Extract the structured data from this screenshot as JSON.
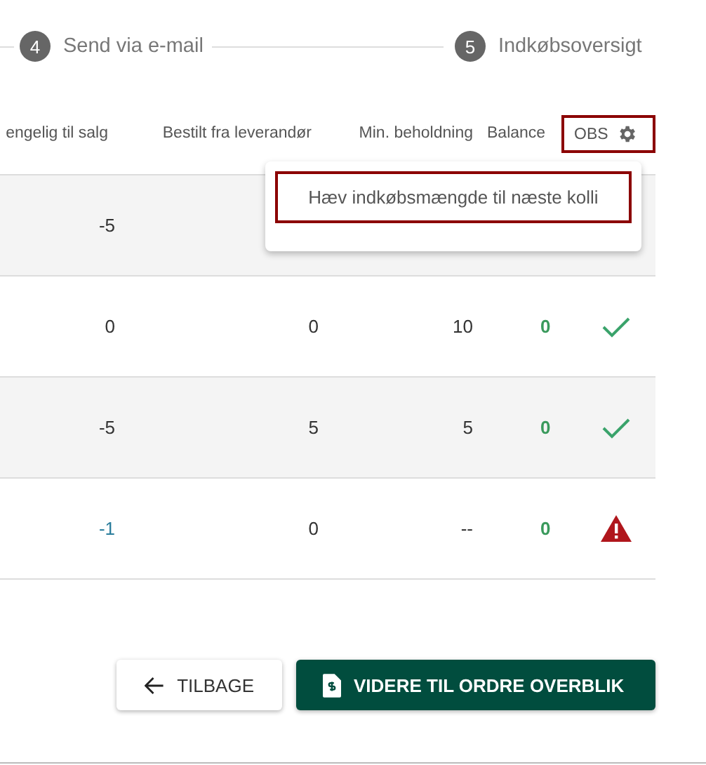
{
  "stepper": [
    {
      "number": "4",
      "label": "Send via e-mail"
    },
    {
      "number": "5",
      "label": "Indkøbsoversigt"
    }
  ],
  "table": {
    "columns": [
      "engelig til salg",
      "Bestilt fra leverandør",
      "Min. beholdning",
      "Balance",
      "OBS"
    ],
    "rows": [
      {
        "cells": [
          "-5"
        ],
        "flagged": false
      },
      {
        "cells": [
          "0",
          "0",
          "10",
          "0"
        ],
        "flagged": false,
        "warning": false
      },
      {
        "cells": [
          "-5",
          "5",
          "5",
          "0"
        ],
        "flagged": false,
        "warning": false
      },
      {
        "cells": [
          "-1",
          "0",
          "--",
          "0"
        ],
        "flagged": true,
        "warning": true
      }
    ]
  },
  "obs_menu": {
    "open": true,
    "items": [
      "Hæv indkøbsmængde til næste kolli"
    ]
  },
  "buttons": {
    "back": "TILBAGE",
    "next": "VIDERE TIL ORDRE OVERBLIK"
  }
}
